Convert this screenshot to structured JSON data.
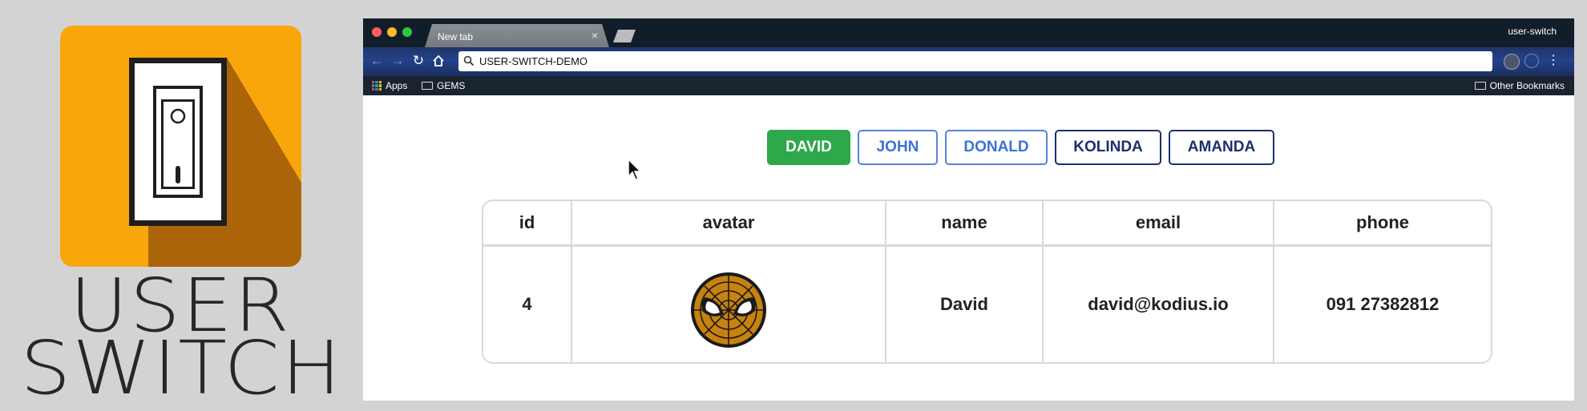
{
  "logo": {
    "line1": "USER",
    "line2": "SWITCH",
    "colors": {
      "tile": "#f9a60b",
      "shadow": "#ab6407",
      "switch": "#1f1f1f"
    }
  },
  "browser": {
    "tab_title": "New tab",
    "tab_close": "×",
    "profile": "user-switch",
    "address": "USER-SWITCH-DEMO",
    "bookmarks": {
      "apps": "Apps",
      "gems": "GEMS",
      "other": "Other Bookmarks"
    },
    "icons": [
      "back-icon",
      "forward-icon",
      "reload-icon",
      "home-icon",
      "search-icon",
      "menu-icon"
    ]
  },
  "users": [
    {
      "label": "DAVID",
      "style": "active",
      "color": "#2da84a"
    },
    {
      "label": "JOHN",
      "style": "light",
      "color": "#3b73d6"
    },
    {
      "label": "DONALD",
      "style": "light",
      "color": "#3b73d6"
    },
    {
      "label": "KOLINDA",
      "style": "dark",
      "color": "#1d2f6e"
    },
    {
      "label": "AMANDA",
      "style": "dark",
      "color": "#1d2f6e"
    }
  ],
  "table": {
    "columns": [
      "id",
      "avatar",
      "name",
      "email",
      "phone"
    ],
    "rows": [
      {
        "id": "4",
        "avatar": "spiderman-avatar",
        "name": "David",
        "email": "david@kodius.io",
        "phone": "091 27382812"
      }
    ]
  }
}
